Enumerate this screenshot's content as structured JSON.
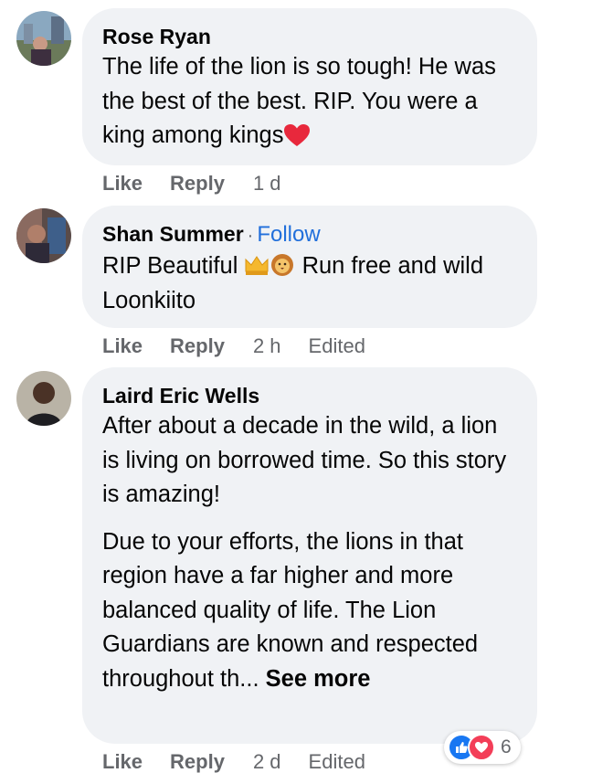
{
  "comments": [
    {
      "author": "Rose Ryan",
      "text": "The life of the lion is so tough! He was the best of the best. RIP. You were a king among kings",
      "like_label": "Like",
      "reply_label": "Reply",
      "time": "1 d",
      "emoji": "red-heart-icon"
    },
    {
      "author": "Shan Summer",
      "separator": "·",
      "follow_label": "Follow",
      "text_before": "RIP Beautiful",
      "text_after": "Run free and wild Loonkiito",
      "like_label": "Like",
      "reply_label": "Reply",
      "time": "2 h",
      "edited": "Edited",
      "emoji": [
        "crown-icon",
        "lion-face-icon"
      ]
    },
    {
      "author": "Laird Eric Wells",
      "paragraph1": "After about a decade in the wild, a lion is living on borrowed time. So this story is amazing!",
      "paragraph2": "Due to your efforts, the lions in that region have a far higher and more balanced quality of life. The Lion Guardians are known and respected throughout th...",
      "see_more": "See more",
      "like_label": "Like",
      "reply_label": "Reply",
      "time": "2 d",
      "edited": "Edited",
      "reactions": {
        "icons": [
          "like-reaction-icon",
          "love-reaction-icon"
        ],
        "count": "6"
      }
    }
  ],
  "colors": {
    "bubble": "#f0f2f5",
    "meta": "#65676b",
    "follow": "#216fdb",
    "like_reaction": "#1877f2",
    "love_reaction": "#f33e58"
  }
}
